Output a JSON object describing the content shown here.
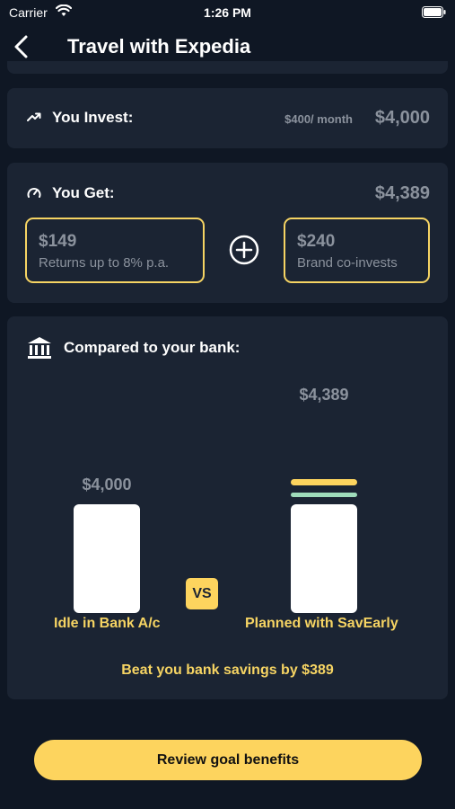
{
  "status_bar": {
    "carrier": "Carrier",
    "time": "1:26 PM"
  },
  "nav": {
    "title": "Travel with Expedia"
  },
  "invest": {
    "label": "You Invest:",
    "monthly": "$400/ month",
    "total": "$4,000"
  },
  "get": {
    "label": "You Get:",
    "total": "$4,389",
    "returns": {
      "amount": "$149",
      "description": "Returns up to 8% p.a."
    },
    "brand": {
      "amount": "$240",
      "description": "Brand co-invests"
    }
  },
  "compare": {
    "title": "Compared to your bank:",
    "vs_label": "VS",
    "bank": {
      "value_label": "$4,000",
      "label": "Idle in Bank A/c"
    },
    "savearly": {
      "value_label": "$4,389",
      "label": "Planned with SavEarly"
    },
    "beat_text": "Beat you bank savings by $389"
  },
  "chart_data": {
    "type": "bar",
    "categories": [
      "Idle in Bank A/c",
      "Planned with SavEarly"
    ],
    "series": [
      {
        "values": [
          4000,
          4000
        ]
      },
      {
        "values": [
          0,
          149
        ]
      },
      {
        "values": [
          0,
          240
        ]
      }
    ],
    "data_labels": [
      "$4,000",
      "$4,389"
    ],
    "colors": [
      "#ffffff",
      "#9fdcbb",
      "#fdd45e"
    ]
  },
  "cta": {
    "label": "Review goal benefits"
  },
  "theme": {
    "background": "#0f1724",
    "card": "#1b2433",
    "accent": "#fdd45e",
    "green": "#9fdcbb",
    "muted_text": "#8b929d"
  }
}
